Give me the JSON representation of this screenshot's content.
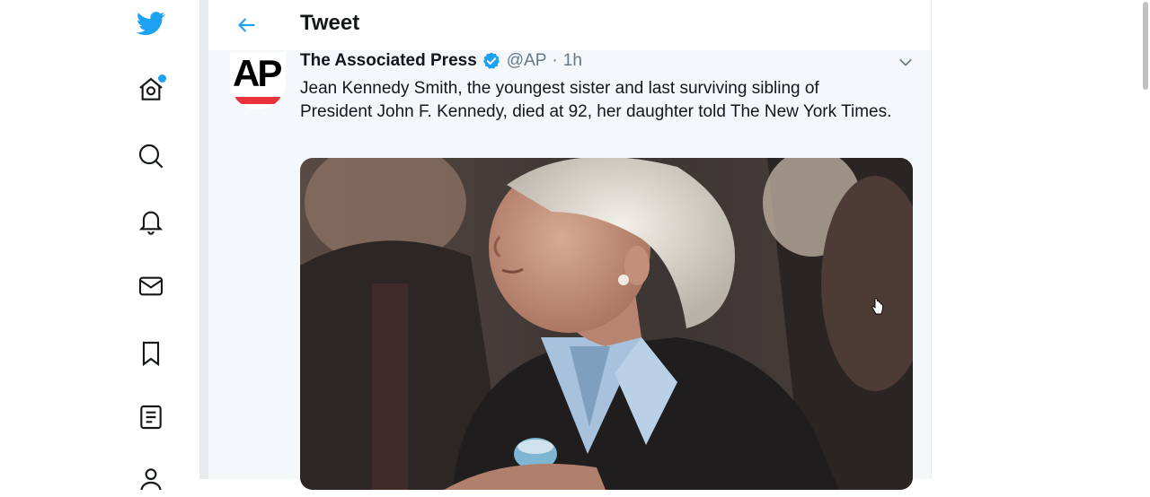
{
  "nav": {
    "items": [
      {
        "name": "twitter-logo-icon"
      },
      {
        "name": "home-icon"
      },
      {
        "name": "explore-icon"
      },
      {
        "name": "notifications-icon"
      },
      {
        "name": "messages-icon"
      },
      {
        "name": "bookmarks-icon"
      },
      {
        "name": "lists-icon"
      },
      {
        "name": "profile-icon"
      }
    ]
  },
  "header": {
    "title": "Tweet"
  },
  "tweet": {
    "author_name": "The Associated Press",
    "handle": "@AP",
    "separator": "·",
    "time": "1h",
    "avatar_text": "AP",
    "text": "Jean Kennedy Smith, the youngest sister and last surviving sibling of President John F. Kennedy, died at 92, her daughter told The New York Times."
  },
  "colors": {
    "accent": "#1da1f2",
    "text": "#14171a",
    "secondary_text": "#657786",
    "ap_red": "#e8323c"
  }
}
